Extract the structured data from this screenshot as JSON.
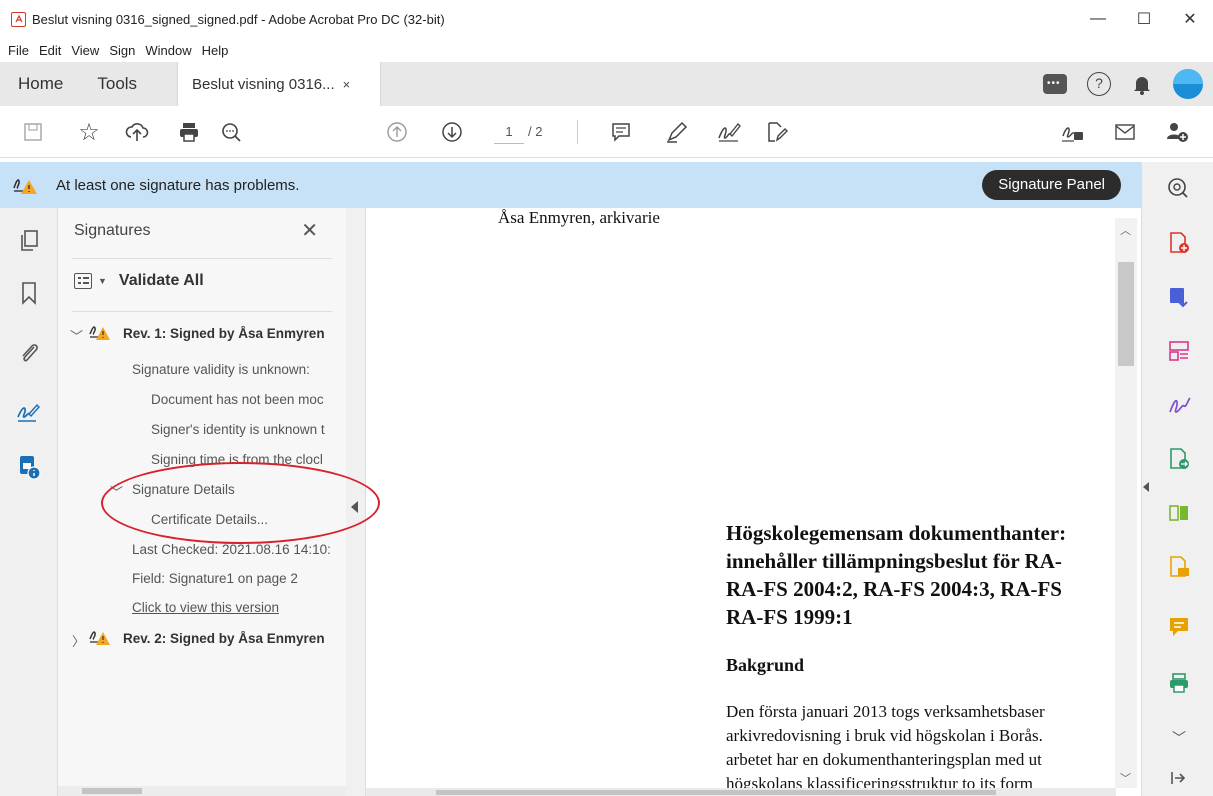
{
  "window": {
    "title": "Beslut visning 0316_signed_signed.pdf - Adobe Acrobat Pro DC (32-bit)",
    "controls": {
      "minimize": "—",
      "maximize": "☐",
      "close": "✕"
    }
  },
  "menu": [
    "File",
    "Edit",
    "View",
    "Sign",
    "Window",
    "Help"
  ],
  "tabs": {
    "home": "Home",
    "tools": "Tools",
    "document": "Beslut visning 0316...",
    "close": "×"
  },
  "toolbar": {
    "current_page": "1",
    "page_total": "/ 2"
  },
  "notification": {
    "message": "At least one signature has problems.",
    "button": "Signature Panel"
  },
  "signatures": {
    "header": "Signatures",
    "close": "✕",
    "validate_all": "Validate All",
    "rev1": {
      "title": "Rev. 1: Signed by Åsa Enmyren",
      "validity": "Signature validity is unknown:",
      "details": [
        "Document has not been moc",
        "Signer's identity is unknown t",
        "Signing time is from the clocl"
      ],
      "signature_details": "Signature Details",
      "certificate_details": "Certificate Details...",
      "last_checked": "Last Checked: 2021.08.16 14:10:",
      "field": "Field: Signature1 on page 2",
      "view_version": "Click to view this version"
    },
    "rev2": {
      "title": "Rev. 2: Signed by Åsa Enmyren"
    }
  },
  "document": {
    "signer_line": "Åsa Enmyren, arkivarie",
    "heading_lines": [
      "Högskolegemensam dokumenthanter:",
      "innehåller tillämpningsbeslut för RA-",
      "RA-FS 2004:2, RA-FS 2004:3, RA-FS",
      "RA-FS 1999:1"
    ],
    "subheading": "Bakgrund",
    "body_lines": [
      "Den första januari 2013 togs verksamhetsbaser",
      "arkivredovisning i bruk vid högskolan i Borås.",
      "arbetet har en dokumenthanteringsplan med ut",
      "högskolans klassificeringsstruktur to its form"
    ]
  },
  "colors": {
    "notification_bg": "#c7e2f6",
    "warning": "#f5a623",
    "annotation": "#d6222a",
    "avatar": "#1a8ed6"
  }
}
